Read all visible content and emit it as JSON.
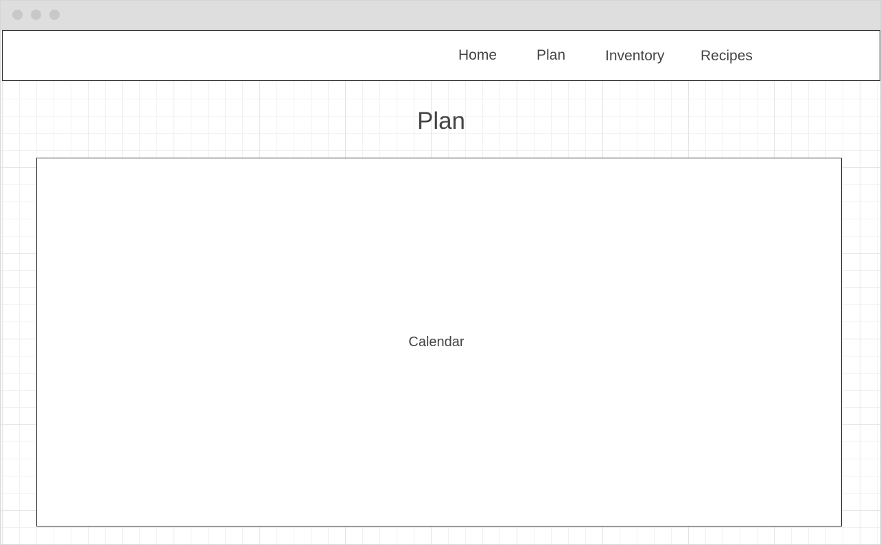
{
  "nav": {
    "items": [
      {
        "label": "Home"
      },
      {
        "label": "Plan"
      },
      {
        "label": "Inventory"
      },
      {
        "label": "Recipes"
      }
    ]
  },
  "main": {
    "title": "Plan",
    "calendar_label": "Calendar"
  }
}
